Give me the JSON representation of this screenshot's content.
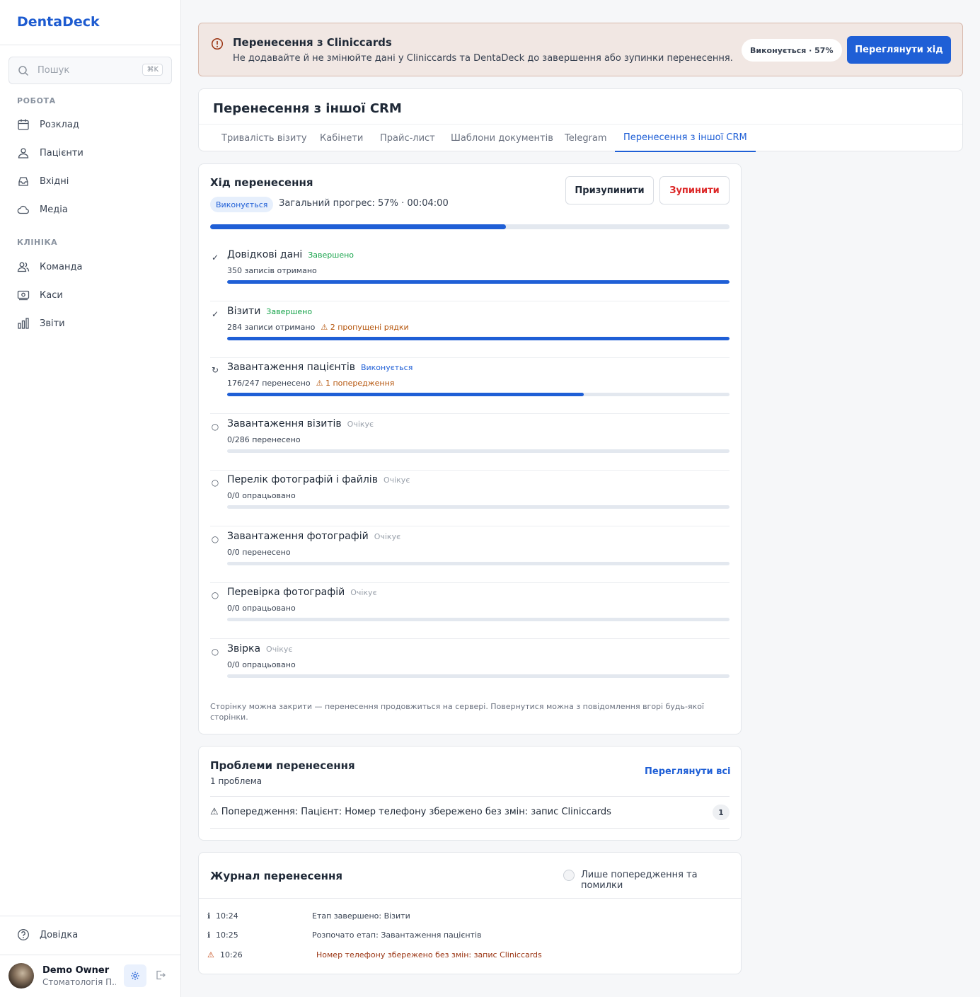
{
  "app": {
    "name": "DentaDeck"
  },
  "search": {
    "placeholder": "Пошук",
    "shortcut": "⌘K"
  },
  "sidebar": {
    "sections": [
      {
        "label": "РОБОТА",
        "items": [
          {
            "label": "Розклад",
            "icon": "calendar-icon"
          },
          {
            "label": "Пацієнти",
            "icon": "patients-icon"
          },
          {
            "label": "Вхідні",
            "icon": "inbox-icon"
          },
          {
            "label": "Медіа",
            "icon": "cloud-icon"
          }
        ]
      },
      {
        "label": "КЛІНІКА",
        "items": [
          {
            "label": "Команда",
            "icon": "team-icon"
          },
          {
            "label": "Каси",
            "icon": "cash-icon"
          },
          {
            "label": "Звіти",
            "icon": "reports-icon"
          }
        ]
      }
    ],
    "help": "Довідка"
  },
  "user": {
    "name": "Demo Owner",
    "clinic": "Стоматологія П..."
  },
  "banner": {
    "title": "Перенесення з Cliniccards",
    "description": "Не додавайте й не змінюйте дані у Cliniccards та DentaDeck до завершення або зупинки перенесення.",
    "status_pill": "Виконується · 57%",
    "action": "Переглянути хід"
  },
  "page": {
    "title": "Перенесення з іншої CRM",
    "tabs": [
      "Тривалість візиту",
      "Кабінети",
      "Прайс-лист",
      "Шаблони документів",
      "Telegram",
      "Перенесення з іншої CRM"
    ],
    "active_tab": 5
  },
  "progress": {
    "title": "Хід перенесення",
    "badge": "Виконується",
    "overall_text": "Загальний прогрес: 57% · 00:04:00",
    "overall_fraction": 0.57,
    "pause_label": "Призупинити",
    "stop_label": "Зупинити",
    "stages": [
      {
        "icon": "✓",
        "name": "Довідкові дані",
        "status": "Завершено",
        "state": "done",
        "detail": "350 записів отримано",
        "warning": "",
        "fraction": 1.0
      },
      {
        "icon": "✓",
        "name": "Візити",
        "status": "Завершено",
        "state": "done",
        "detail": "284 записи отримано",
        "warning": "⚠ 2 пропущені рядки",
        "fraction": 1.0
      },
      {
        "icon": "↻",
        "name": "Завантаження пацієнтів",
        "status": "Виконується",
        "state": "running",
        "detail": "176/247 перенесено",
        "warning": "⚠ 1 попередження",
        "fraction": 0.71
      },
      {
        "icon": "○",
        "name": "Завантаження візитів",
        "status": "Очікує",
        "state": "pending",
        "detail": "0/286 перенесено",
        "warning": "",
        "fraction": 0
      },
      {
        "icon": "○",
        "name": "Перелік фотографій і файлів",
        "status": "Очікує",
        "state": "pending",
        "detail": "0/0 опрацьовано",
        "warning": "",
        "fraction": 0
      },
      {
        "icon": "○",
        "name": "Завантаження фотографій",
        "status": "Очікує",
        "state": "pending",
        "detail": "0/0 перенесено",
        "warning": "",
        "fraction": 0
      },
      {
        "icon": "○",
        "name": "Перевірка фотографій",
        "status": "Очікує",
        "state": "pending",
        "detail": "0/0 опрацьовано",
        "warning": "",
        "fraction": 0
      },
      {
        "icon": "○",
        "name": "Звірка",
        "status": "Очікує",
        "state": "pending",
        "detail": "0/0 опрацьовано",
        "warning": "",
        "fraction": 0
      }
    ],
    "note": "Сторінку можна закрити — перенесення продовжиться на сервері. Повернутися можна з повідомлення вгорі будь-якої сторінки."
  },
  "issues": {
    "title": "Проблеми перенесення",
    "count_text": "1 проблема",
    "view_all": "Переглянути всі",
    "items": [
      {
        "text": "⚠  Попередження: Пацієнт: Номер телефону збережено без змін: запис Cliniccards",
        "count": "1"
      }
    ]
  },
  "log": {
    "title": "Журнал перенесення",
    "filter_label": "Лише попередження та помилки",
    "entries": [
      {
        "icon": "ℹ",
        "time": "10:24",
        "message": "Етап завершено: Візити",
        "level": "info"
      },
      {
        "icon": "ℹ",
        "time": "10:25",
        "message": "Розпочато етап: Завантаження пацієнтів",
        "level": "info"
      },
      {
        "icon": "⚠",
        "time": "10:26",
        "message": "Номер телефону збережено без змін: запис Cliniccards",
        "level": "warning"
      }
    ]
  },
  "colors": {
    "accent": "#1f5fd6",
    "success": "#16a34a",
    "warning": "#b45309",
    "danger": "#dc2626",
    "banner_bg": "#f1e7e3"
  }
}
